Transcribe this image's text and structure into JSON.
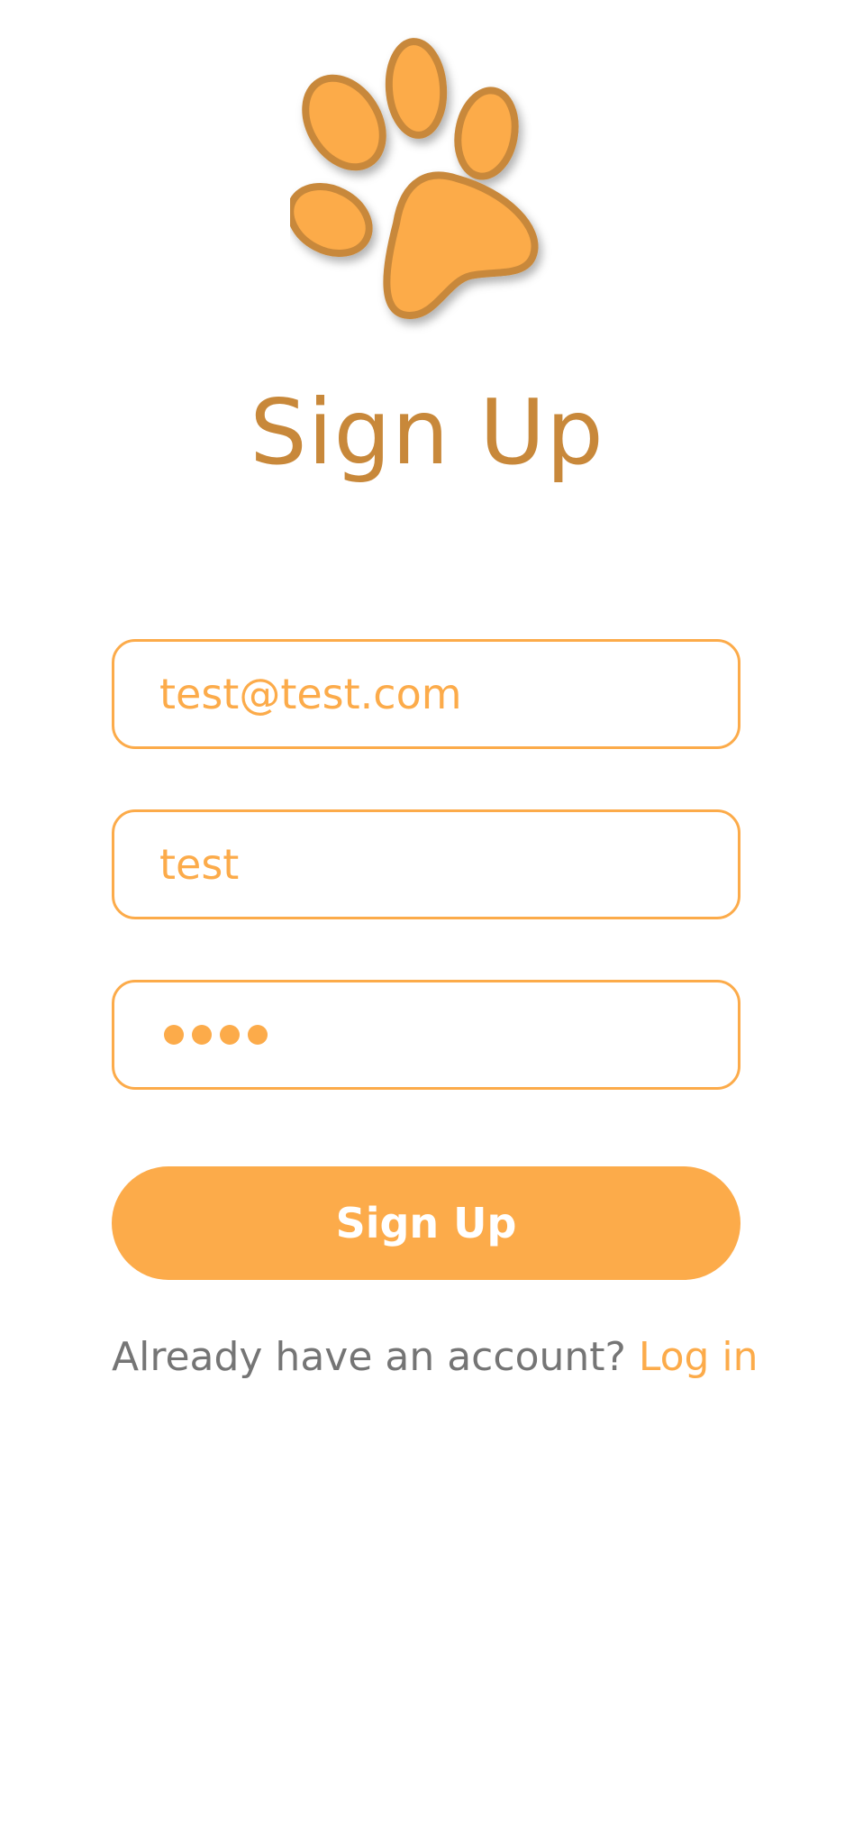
{
  "logo": {
    "icon": "paw-icon",
    "fill_color": "#fcab4a",
    "outline_color": "#c8883a"
  },
  "title": "Sign Up",
  "form": {
    "email_value": "test@test.com",
    "username_value": "test",
    "password_length": 4,
    "submit_label": "Sign Up"
  },
  "footer": {
    "question": "Already have an account?",
    "link_label": "Log in"
  },
  "colors": {
    "accent": "#fcab4a",
    "title": "#c8883a",
    "muted_text": "#757575",
    "background": "#ffffff"
  }
}
